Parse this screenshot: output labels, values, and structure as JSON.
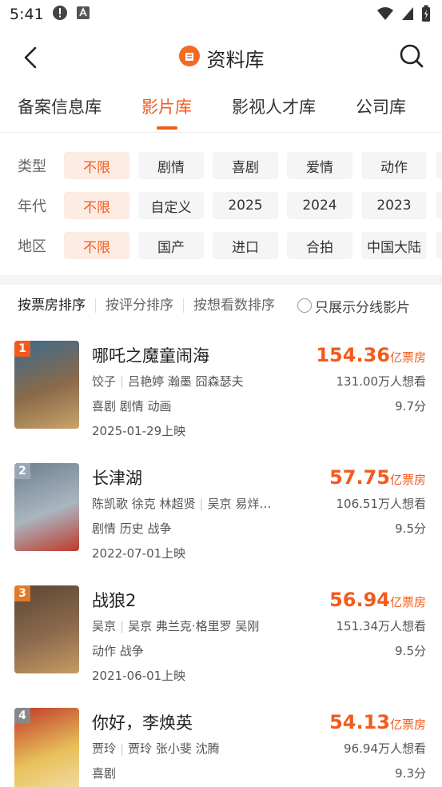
{
  "status": {
    "time": "5:41"
  },
  "nav": {
    "title": "资料库"
  },
  "tabs": [
    {
      "label": "备案信息库",
      "active": false
    },
    {
      "label": "影片库",
      "active": true
    },
    {
      "label": "影视人才库",
      "active": false
    },
    {
      "label": "公司库",
      "active": false
    }
  ],
  "filters": [
    {
      "label": "类型",
      "options": [
        "不限",
        "剧情",
        "喜剧",
        "爱情",
        "动作"
      ]
    },
    {
      "label": "年代",
      "options": [
        "不限",
        "自定义",
        "2025",
        "2024",
        "2023"
      ]
    },
    {
      "label": "地区",
      "options": [
        "不限",
        "国产",
        "进口",
        "合拍",
        "中国大陆"
      ]
    }
  ],
  "sort": {
    "options": [
      "按票房排序",
      "按评分排序",
      "按想看数排序"
    ],
    "toggle_label": "只展示分线影片"
  },
  "movies": [
    {
      "rank": "1",
      "title": "哪吒之魔童闹海",
      "director": "饺子",
      "cast": "吕艳婷 瀚墨 囧森瑟夫",
      "genres": "喜剧 剧情 动画",
      "release": "2025-01-29上映",
      "box_num": "154.36",
      "box_unit": "亿票房",
      "want": "131.00万人想看",
      "score": "9.7分",
      "rank_color": "#f25b1d",
      "poster_colors": [
        "#3b6b8c",
        "#8a6a4a",
        "#c9a46a"
      ]
    },
    {
      "rank": "2",
      "title": "长津湖",
      "director": "陈凯歌 徐克 林超贤",
      "cast": "吴京 易烊…",
      "genres": "剧情 历史 战争",
      "release": "2022-07-01上映",
      "box_num": "57.75",
      "box_unit": "亿票房",
      "want": "106.51万人想看",
      "score": "9.5分",
      "rank_color": "#9aa7b6",
      "poster_colors": [
        "#6d7f8e",
        "#a9b6c0",
        "#c0392b"
      ]
    },
    {
      "rank": "3",
      "title": "战狼2",
      "director": "吴京",
      "cast": "吴京 弗兰克·格里罗 吴刚",
      "genres": "动作 战争",
      "release": "2021-06-01上映",
      "box_num": "56.94",
      "box_unit": "亿票房",
      "want": "151.34万人想看",
      "score": "9.5分",
      "rank_color": "#e07b2e",
      "poster_colors": [
        "#5a4634",
        "#8b6a4d",
        "#c79a62"
      ]
    },
    {
      "rank": "4",
      "title": "你好，李焕英",
      "director": "贾玲",
      "cast": "贾玲 张小斐 沈腾",
      "genres": "喜剧",
      "release": "",
      "box_num": "54.13",
      "box_unit": "亿票房",
      "want": "96.94万人想看",
      "score": "9.3分",
      "rank_color": "#888888",
      "poster_colors": [
        "#c0392b",
        "#e8c15a",
        "#f3ddb0"
      ]
    }
  ]
}
